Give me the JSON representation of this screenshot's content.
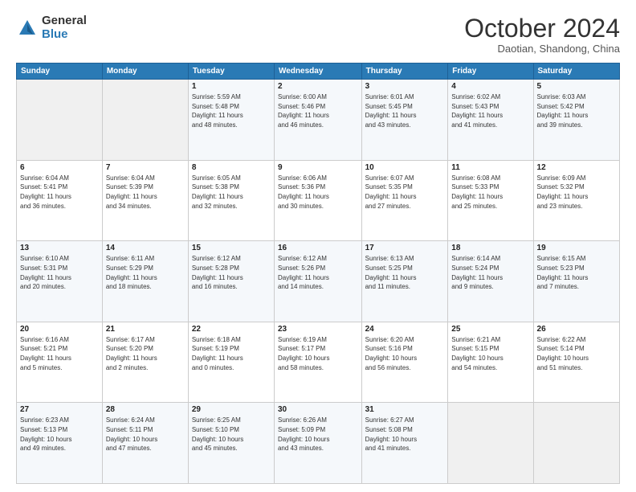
{
  "logo": {
    "general": "General",
    "blue": "Blue"
  },
  "header": {
    "month": "October 2024",
    "location": "Daotian, Shandong, China"
  },
  "days_of_week": [
    "Sunday",
    "Monday",
    "Tuesday",
    "Wednesday",
    "Thursday",
    "Friday",
    "Saturday"
  ],
  "weeks": [
    [
      {
        "day": "",
        "info": ""
      },
      {
        "day": "",
        "info": ""
      },
      {
        "day": "1",
        "info": "Sunrise: 5:59 AM\nSunset: 5:48 PM\nDaylight: 11 hours\nand 48 minutes."
      },
      {
        "day": "2",
        "info": "Sunrise: 6:00 AM\nSunset: 5:46 PM\nDaylight: 11 hours\nand 46 minutes."
      },
      {
        "day": "3",
        "info": "Sunrise: 6:01 AM\nSunset: 5:45 PM\nDaylight: 11 hours\nand 43 minutes."
      },
      {
        "day": "4",
        "info": "Sunrise: 6:02 AM\nSunset: 5:43 PM\nDaylight: 11 hours\nand 41 minutes."
      },
      {
        "day": "5",
        "info": "Sunrise: 6:03 AM\nSunset: 5:42 PM\nDaylight: 11 hours\nand 39 minutes."
      }
    ],
    [
      {
        "day": "6",
        "info": "Sunrise: 6:04 AM\nSunset: 5:41 PM\nDaylight: 11 hours\nand 36 minutes."
      },
      {
        "day": "7",
        "info": "Sunrise: 6:04 AM\nSunset: 5:39 PM\nDaylight: 11 hours\nand 34 minutes."
      },
      {
        "day": "8",
        "info": "Sunrise: 6:05 AM\nSunset: 5:38 PM\nDaylight: 11 hours\nand 32 minutes."
      },
      {
        "day": "9",
        "info": "Sunrise: 6:06 AM\nSunset: 5:36 PM\nDaylight: 11 hours\nand 30 minutes."
      },
      {
        "day": "10",
        "info": "Sunrise: 6:07 AM\nSunset: 5:35 PM\nDaylight: 11 hours\nand 27 minutes."
      },
      {
        "day": "11",
        "info": "Sunrise: 6:08 AM\nSunset: 5:33 PM\nDaylight: 11 hours\nand 25 minutes."
      },
      {
        "day": "12",
        "info": "Sunrise: 6:09 AM\nSunset: 5:32 PM\nDaylight: 11 hours\nand 23 minutes."
      }
    ],
    [
      {
        "day": "13",
        "info": "Sunrise: 6:10 AM\nSunset: 5:31 PM\nDaylight: 11 hours\nand 20 minutes."
      },
      {
        "day": "14",
        "info": "Sunrise: 6:11 AM\nSunset: 5:29 PM\nDaylight: 11 hours\nand 18 minutes."
      },
      {
        "day": "15",
        "info": "Sunrise: 6:12 AM\nSunset: 5:28 PM\nDaylight: 11 hours\nand 16 minutes."
      },
      {
        "day": "16",
        "info": "Sunrise: 6:12 AM\nSunset: 5:26 PM\nDaylight: 11 hours\nand 14 minutes."
      },
      {
        "day": "17",
        "info": "Sunrise: 6:13 AM\nSunset: 5:25 PM\nDaylight: 11 hours\nand 11 minutes."
      },
      {
        "day": "18",
        "info": "Sunrise: 6:14 AM\nSunset: 5:24 PM\nDaylight: 11 hours\nand 9 minutes."
      },
      {
        "day": "19",
        "info": "Sunrise: 6:15 AM\nSunset: 5:23 PM\nDaylight: 11 hours\nand 7 minutes."
      }
    ],
    [
      {
        "day": "20",
        "info": "Sunrise: 6:16 AM\nSunset: 5:21 PM\nDaylight: 11 hours\nand 5 minutes."
      },
      {
        "day": "21",
        "info": "Sunrise: 6:17 AM\nSunset: 5:20 PM\nDaylight: 11 hours\nand 2 minutes."
      },
      {
        "day": "22",
        "info": "Sunrise: 6:18 AM\nSunset: 5:19 PM\nDaylight: 11 hours\nand 0 minutes."
      },
      {
        "day": "23",
        "info": "Sunrise: 6:19 AM\nSunset: 5:17 PM\nDaylight: 10 hours\nand 58 minutes."
      },
      {
        "day": "24",
        "info": "Sunrise: 6:20 AM\nSunset: 5:16 PM\nDaylight: 10 hours\nand 56 minutes."
      },
      {
        "day": "25",
        "info": "Sunrise: 6:21 AM\nSunset: 5:15 PM\nDaylight: 10 hours\nand 54 minutes."
      },
      {
        "day": "26",
        "info": "Sunrise: 6:22 AM\nSunset: 5:14 PM\nDaylight: 10 hours\nand 51 minutes."
      }
    ],
    [
      {
        "day": "27",
        "info": "Sunrise: 6:23 AM\nSunset: 5:13 PM\nDaylight: 10 hours\nand 49 minutes."
      },
      {
        "day": "28",
        "info": "Sunrise: 6:24 AM\nSunset: 5:11 PM\nDaylight: 10 hours\nand 47 minutes."
      },
      {
        "day": "29",
        "info": "Sunrise: 6:25 AM\nSunset: 5:10 PM\nDaylight: 10 hours\nand 45 minutes."
      },
      {
        "day": "30",
        "info": "Sunrise: 6:26 AM\nSunset: 5:09 PM\nDaylight: 10 hours\nand 43 minutes."
      },
      {
        "day": "31",
        "info": "Sunrise: 6:27 AM\nSunset: 5:08 PM\nDaylight: 10 hours\nand 41 minutes."
      },
      {
        "day": "",
        "info": ""
      },
      {
        "day": "",
        "info": ""
      }
    ]
  ]
}
